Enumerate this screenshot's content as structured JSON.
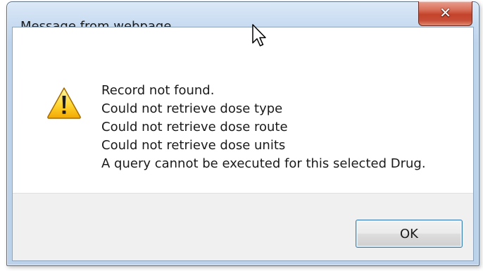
{
  "dialog": {
    "title": "Message from webpage",
    "close_icon": "close-icon",
    "warning_icon": "warning-icon",
    "message_lines": [
      "Record not found.",
      "Could not retrieve dose type",
      "Could not retrieve dose route",
      "Could not retrieve dose units",
      "A query cannot be executed for this selected Drug."
    ],
    "ok_label": "OK"
  },
  "colors": {
    "frame": "#bcd1ea",
    "close_button": "#c4432b",
    "button_area": "#f0f0f0",
    "ok_border": "#3c7fb1"
  }
}
